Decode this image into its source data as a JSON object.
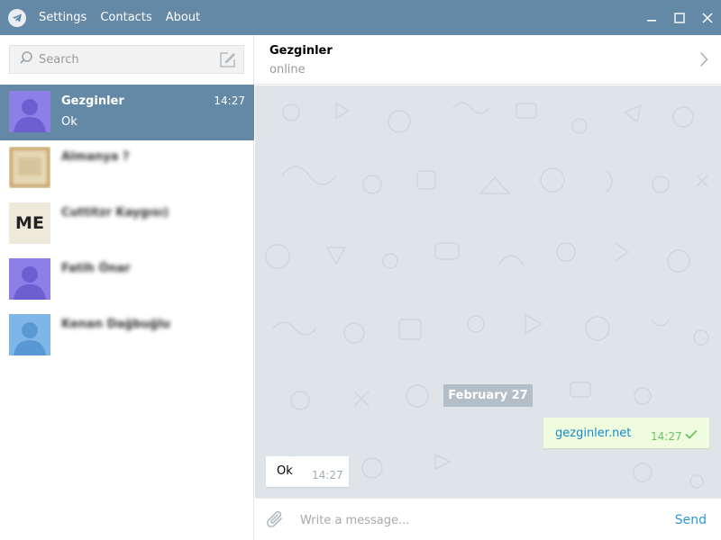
{
  "titlebar": {
    "menu": [
      "Settings",
      "Contacts",
      "About"
    ],
    "icons": [
      "telegram-logo",
      "minimize-icon",
      "maximize-icon",
      "close-icon"
    ]
  },
  "sidebar": {
    "search_placeholder": "Search",
    "dialogs": [
      {
        "name": "Gezginler",
        "time": "14:27",
        "message": "Ok",
        "active": true,
        "avatar": "purple-person"
      },
      {
        "name": "Almanya ?",
        "time": "",
        "message": "",
        "active": false,
        "avatar": "photo-blurred"
      },
      {
        "name": "Cuttitzr Kaygısı)",
        "time": "",
        "message": "",
        "active": false,
        "avatar": "ME"
      },
      {
        "name": "Fatih Önar",
        "time": "",
        "message": "",
        "active": false,
        "avatar": "purple-person"
      },
      {
        "name": "Kenan Dağbuğlu",
        "time": "",
        "message": "",
        "active": false,
        "avatar": "blue-person"
      }
    ]
  },
  "chat": {
    "title": "Gezginler",
    "status": "online",
    "date_separator": "February 27",
    "messages": [
      {
        "direction": "out",
        "text": "gezginler.net",
        "time": "14:27",
        "read": true
      },
      {
        "direction": "in",
        "text": "Ok",
        "time": "14:27"
      }
    ],
    "input_placeholder": "Write a message...",
    "send_label": "Send"
  },
  "colors": {
    "titlebar": "#6489a6",
    "active_dialog": "#6489a6",
    "chat_bg": "#dfe4e8",
    "out_bubble": "#effdde",
    "link": "#168acd",
    "send": "#2b9ad1"
  }
}
